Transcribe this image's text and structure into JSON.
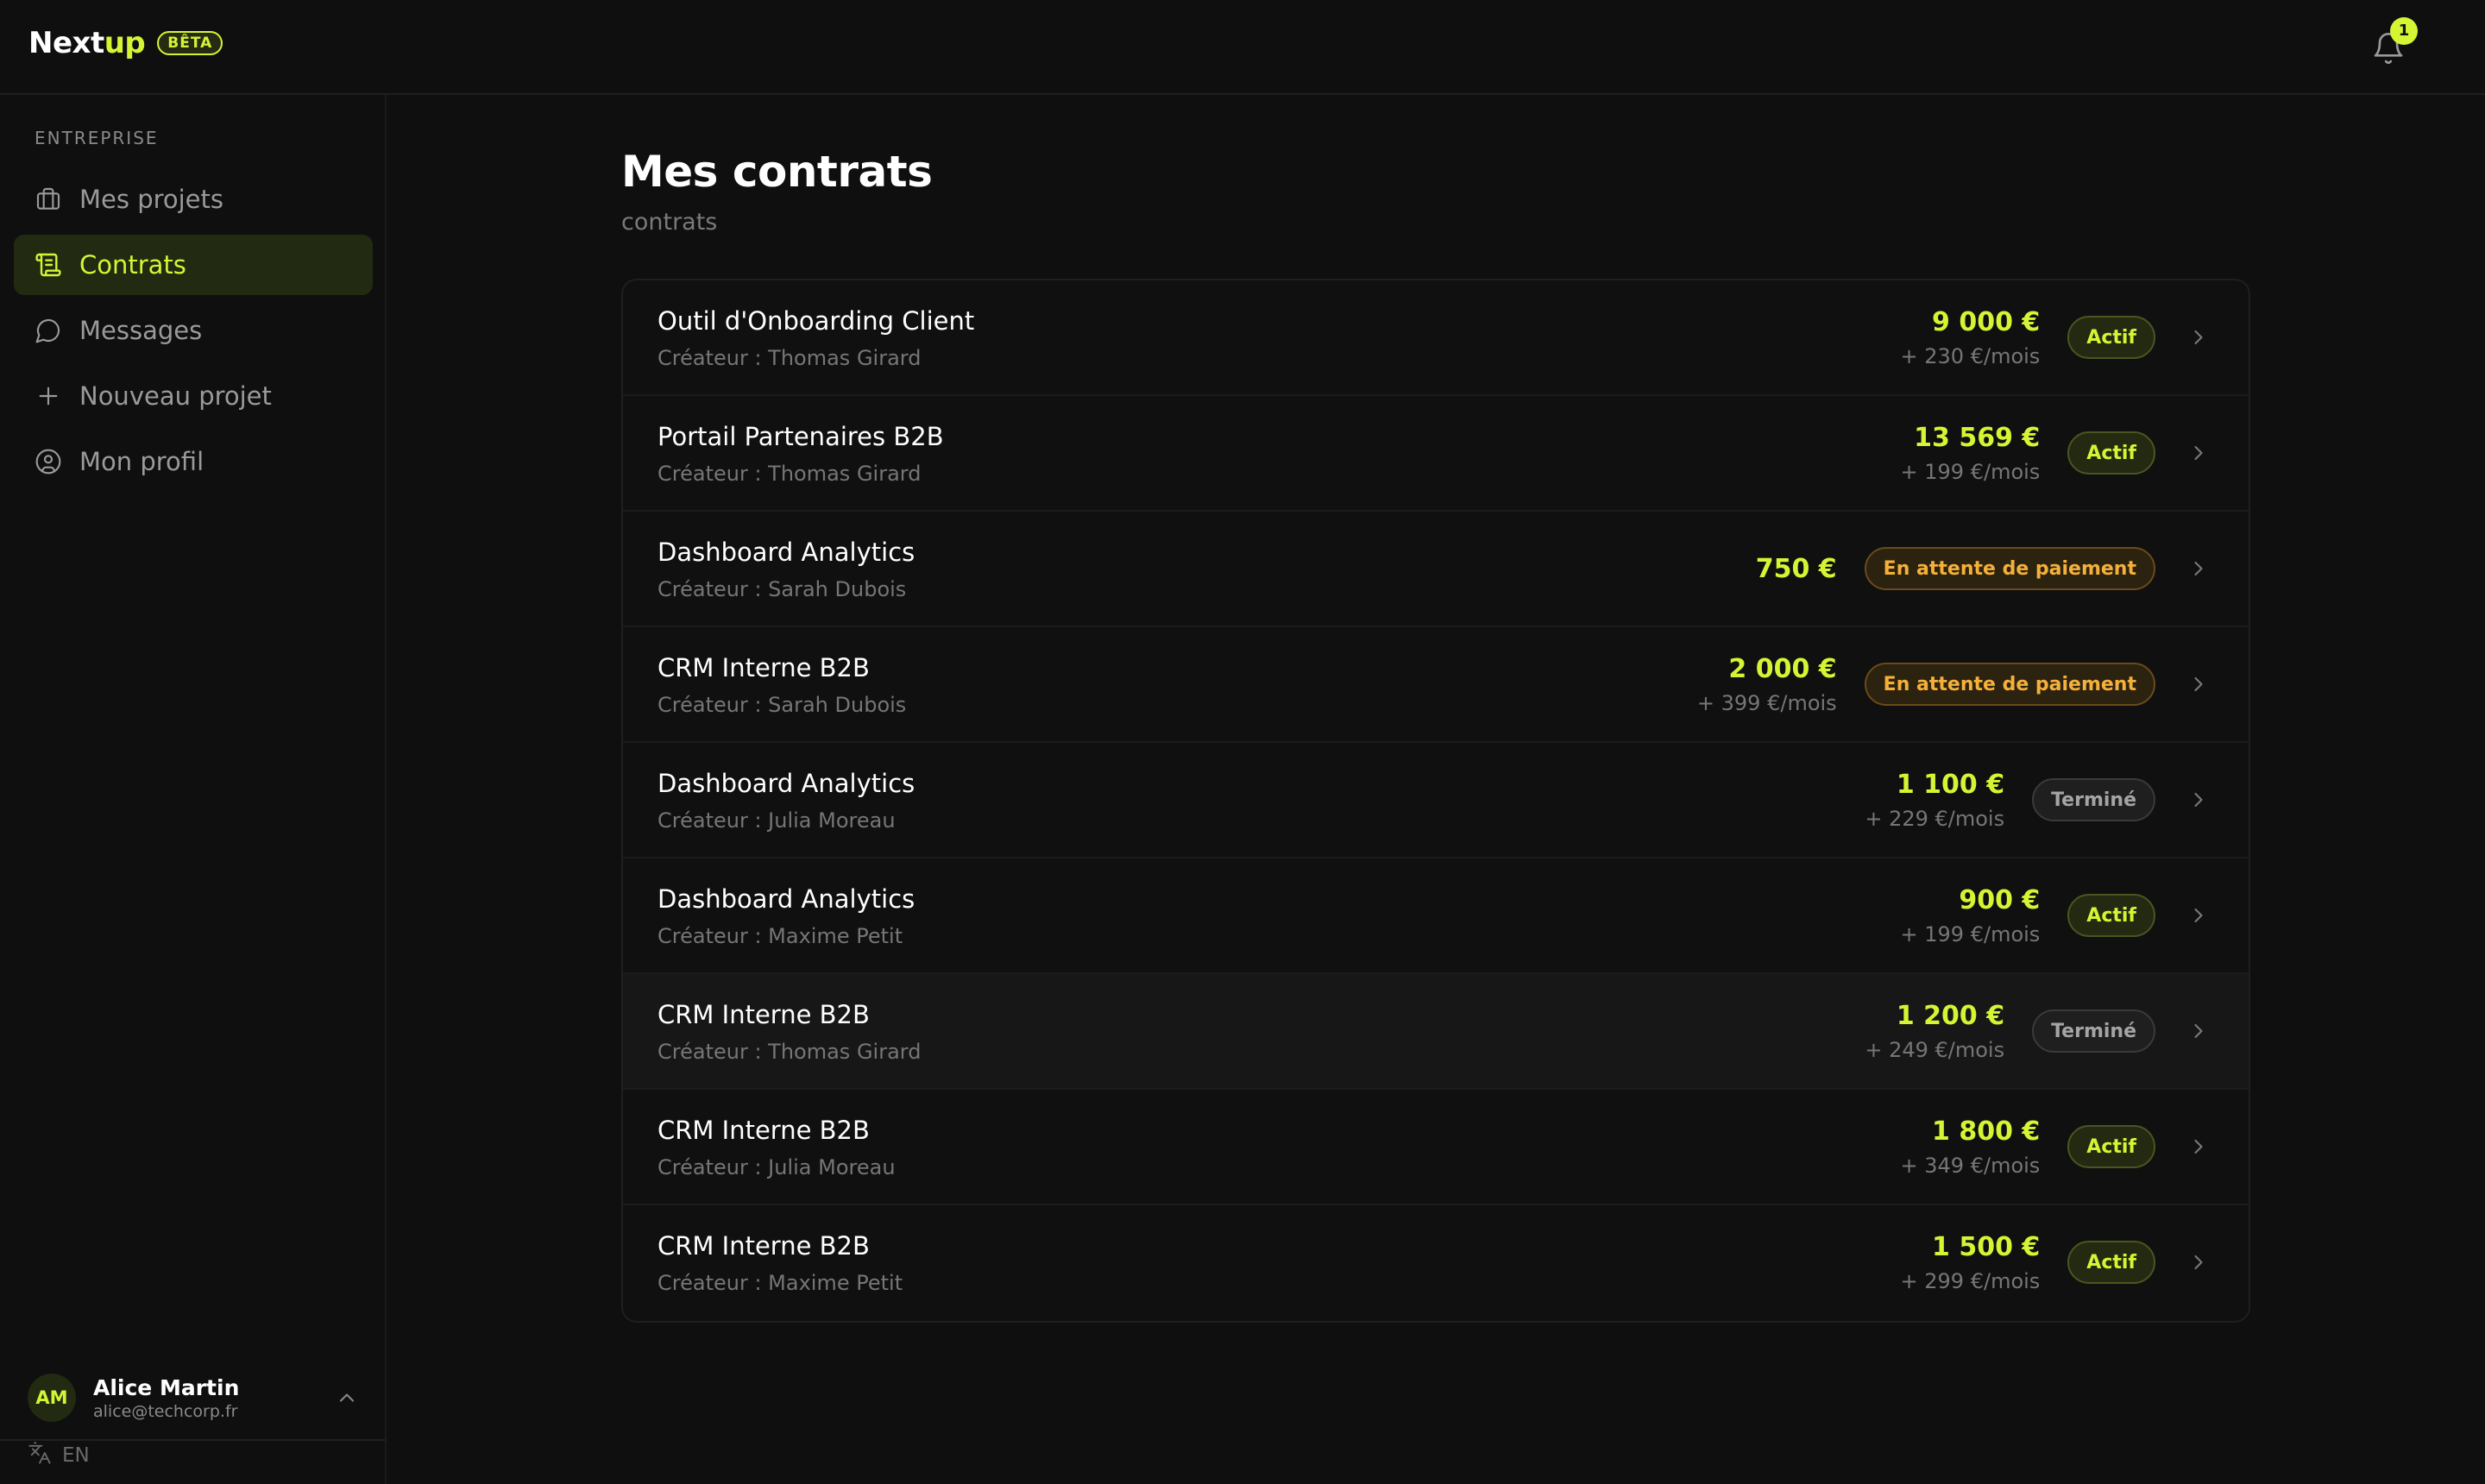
{
  "app": {
    "brand_prefix": "Next",
    "brand_suffix": "up",
    "beta": "BÊTA",
    "notification_count": "1",
    "accent": "#d4f534"
  },
  "sidebar": {
    "section_label": "ENTREPRISE",
    "items": [
      {
        "label": "Mes projets",
        "icon": "briefcase-icon",
        "active": false
      },
      {
        "label": "Contrats",
        "icon": "document-icon",
        "active": true
      },
      {
        "label": "Messages",
        "icon": "message-icon",
        "active": false
      },
      {
        "label": "Nouveau projet",
        "icon": "plus-icon",
        "active": false
      },
      {
        "label": "Mon profil",
        "icon": "user-circle-icon",
        "active": false
      }
    ],
    "user": {
      "initials": "AM",
      "name": "Alice Martin",
      "email": "alice@techcorp.fr"
    },
    "language": "EN"
  },
  "main": {
    "title": "Mes contrats",
    "subtitle": "contrats",
    "contracts": [
      {
        "name": "Outil d'Onboarding Client",
        "creator": "Créateur : Thomas Girard",
        "amount": "9 000 €",
        "monthly": "+ 230 €/mois",
        "status": "Actif",
        "status_type": "actif"
      },
      {
        "name": "Portail Partenaires B2B",
        "creator": "Créateur : Thomas Girard",
        "amount": "13 569 €",
        "monthly": "+ 199 €/mois",
        "status": "Actif",
        "status_type": "actif"
      },
      {
        "name": "Dashboard Analytics",
        "creator": "Créateur : Sarah Dubois",
        "amount": "750 €",
        "monthly": "",
        "status": "En attente de paiement",
        "status_type": "attente"
      },
      {
        "name": "CRM Interne B2B",
        "creator": "Créateur : Sarah Dubois",
        "amount": "2 000 €",
        "monthly": "+ 399 €/mois",
        "status": "En attente de paiement",
        "status_type": "attente"
      },
      {
        "name": "Dashboard Analytics",
        "creator": "Créateur : Julia Moreau",
        "amount": "1 100 €",
        "monthly": "+ 229 €/mois",
        "status": "Terminé",
        "status_type": "termine"
      },
      {
        "name": "Dashboard Analytics",
        "creator": "Créateur : Maxime Petit",
        "amount": "900 €",
        "monthly": "+ 199 €/mois",
        "status": "Actif",
        "status_type": "actif"
      },
      {
        "name": "CRM Interne B2B",
        "creator": "Créateur : Thomas Girard",
        "amount": "1 200 €",
        "monthly": "+ 249 €/mois",
        "status": "Terminé",
        "status_type": "termine",
        "highlighted": true
      },
      {
        "name": "CRM Interne B2B",
        "creator": "Créateur : Julia Moreau",
        "amount": "1 800 €",
        "monthly": "+ 349 €/mois",
        "status": "Actif",
        "status_type": "actif"
      },
      {
        "name": "CRM Interne B2B",
        "creator": "Créateur : Maxime Petit",
        "amount": "1 500 €",
        "monthly": "+ 299 €/mois",
        "status": "Actif",
        "status_type": "actif"
      }
    ]
  }
}
